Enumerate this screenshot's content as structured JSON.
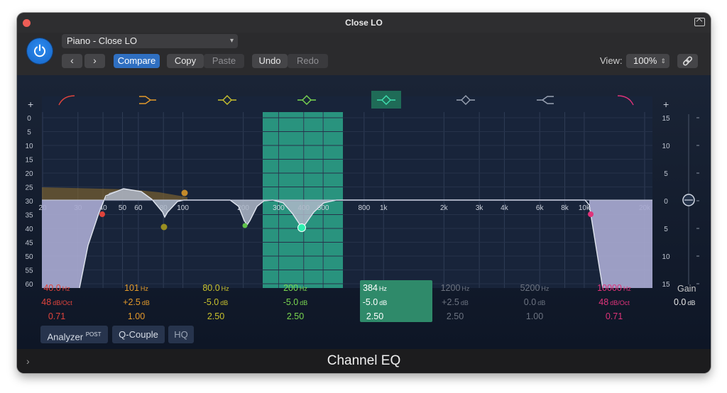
{
  "window": {
    "title": "Close LO",
    "footer_title": "Channel EQ"
  },
  "header": {
    "preset": "Piano - Close LO",
    "buttons": {
      "back": "‹",
      "forward": "›",
      "compare": "Compare",
      "copy": "Copy",
      "paste": "Paste",
      "undo": "Undo",
      "redo": "Redo"
    },
    "view_label": "View:",
    "view_value": "100%"
  },
  "graph": {
    "plus_left": "+",
    "plus_right": "+",
    "db_scale_left": [
      "0",
      "5",
      "10",
      "15",
      "20",
      "25",
      "30",
      "35",
      "40",
      "45",
      "50",
      "55",
      "60"
    ],
    "gain_scale_right": [
      "15",
      "10",
      "5",
      "0",
      "5",
      "10",
      "15"
    ],
    "freq_labels": [
      "20",
      "30",
      "40",
      "50",
      "60",
      "80",
      "100",
      "200",
      "300",
      "400",
      "500",
      "800",
      "1k",
      "2k",
      "3k",
      "4k",
      "6k",
      "8k",
      "10k",
      "20k"
    ],
    "band_icons": [
      "low-cut-icon",
      "low-shelf-icon",
      "peak-icon",
      "peak-icon",
      "peak-icon",
      "peak-icon",
      "high-shelf-icon",
      "high-cut-icon"
    ],
    "colors": [
      "#e0443c",
      "#e39a2b",
      "#c9c22d",
      "#7ad650",
      "#3fe0b0",
      "#9aa3b3",
      "#9aa3b3",
      "#e0337a"
    ]
  },
  "bands": [
    {
      "freq": "40.0",
      "freq_unit": "Hz",
      "gain": "48",
      "gain_unit": "dB/Oct",
      "q": "0.71",
      "color": "#e0443c"
    },
    {
      "freq": "101",
      "freq_unit": "Hz",
      "gain": "+2.5",
      "gain_unit": "dB",
      "q": "1.00",
      "color": "#e39a2b"
    },
    {
      "freq": "80.0",
      "freq_unit": "Hz",
      "gain": "-5.0",
      "gain_unit": "dB",
      "q": "2.50",
      "color": "#c9c22d"
    },
    {
      "freq": "200",
      "freq_unit": "Hz",
      "gain": "-5.0",
      "gain_unit": "dB",
      "q": "2.50",
      "color": "#7ad650"
    },
    {
      "freq": "384",
      "freq_unit": "Hz",
      "gain": "-5.0",
      "gain_unit": "dB",
      "q": "2.50",
      "color": "#ffffff"
    },
    {
      "freq": "1200",
      "freq_unit": "Hz",
      "gain": "+2.5",
      "gain_unit": "dB",
      "q": "2.50",
      "color": "#6c7380"
    },
    {
      "freq": "5200",
      "freq_unit": "Hz",
      "gain": "0.0",
      "gain_unit": "dB",
      "q": "1.00",
      "color": "#6c7380"
    },
    {
      "freq": "10000",
      "freq_unit": "Hz",
      "gain": "48",
      "gain_unit": "dB/Oct",
      "q": "0.71",
      "color": "#e0337a"
    }
  ],
  "gain": {
    "label": "Gain",
    "value": "0.0",
    "unit": "dB"
  },
  "bottom_buttons": {
    "analyzer": "Analyzer",
    "analyzer_sup": "POST",
    "q_couple": "Q-Couple",
    "hq": "HQ"
  }
}
